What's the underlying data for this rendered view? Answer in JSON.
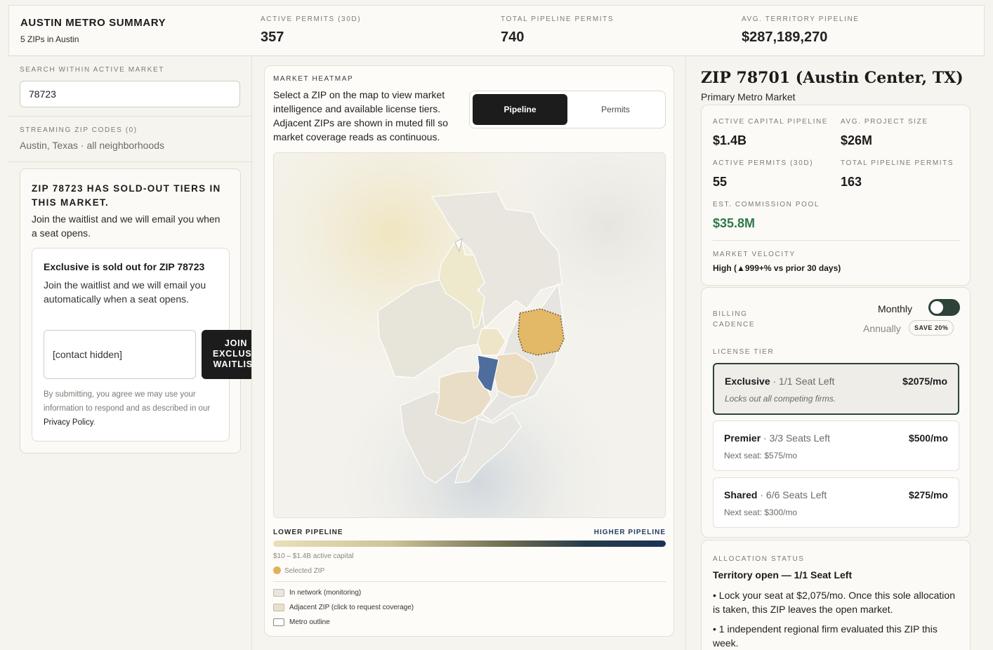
{
  "summary": {
    "title": "AUSTIN METRO SUMMARY",
    "subtitle": "5 ZIPs in Austin",
    "kpis": [
      {
        "label": "ACTIVE PERMITS (30D)",
        "value": "357"
      },
      {
        "label": "TOTAL PIPELINE PERMITS",
        "value": "740"
      },
      {
        "label": "AVG. TERRITORY PIPELINE",
        "value": "$287,189,270"
      }
    ]
  },
  "left": {
    "search_label": "SEARCH WITHIN ACTIVE MARKET",
    "search_value": "78723",
    "streaming_label": "STREAMING ZIP CODES (0)",
    "streaming_sub": "Austin, Texas · all neighborhoods",
    "sold_title": "ZIP 78723 HAS SOLD-OUT TIERS IN THIS MARKET.",
    "sold_text": "Join the waitlist and we will email you when a seat opens.",
    "inner_title": "Exclusive is sold out for ZIP 78723",
    "inner_text": "Join the waitlist and we will email you automatically when a seat opens.",
    "contact_value": "[contact hidden]",
    "join_label": "JOIN EXCLUSIVE WAITLIST",
    "legal_text": "By submitting, you agree we may use your information to respond and as described in our",
    "legal_link": "Privacy Policy",
    "legal_end": "."
  },
  "middle": {
    "label": "MARKET HEATMAP",
    "description": "Select a ZIP on the map to view market intelligence and available license tiers. Adjacent ZIPs are shown in muted fill so market coverage reads as continuous.",
    "toggle_active": "Pipeline",
    "toggle_inactive": "Permits",
    "legend_low": "LOWER PIPELINE",
    "legend_high": "HIGHER PIPELINE",
    "range": "$10 – $1.4B active capital",
    "selected": "Selected ZIP",
    "legend_items": [
      {
        "label": "In network (monitoring)"
      },
      {
        "label": "Adjacent ZIP (click to request coverage)"
      },
      {
        "label": "Metro outline"
      }
    ]
  },
  "right": {
    "zip_title": "ZIP 78701 (Austin Center, TX)",
    "zip_sub": "Primary Metro Market",
    "stats": [
      {
        "label": "ACTIVE CAPITAL PIPELINE",
        "value": "$1.4B"
      },
      {
        "label": "AVG. PROJECT SIZE",
        "value": "$26M"
      },
      {
        "label": "ACTIVE PERMITS (30D)",
        "value": "55"
      },
      {
        "label": "TOTAL PIPELINE PERMITS",
        "value": "163"
      },
      {
        "label": "EST. COMMISSION POOL",
        "value": "$35.8M"
      }
    ],
    "velocity_label": "MARKET VELOCITY",
    "velocity_value": "High (▲999+% vs prior 30 days)",
    "billing_label": "BILLING CADENCE",
    "monthly": "Monthly",
    "annually": "Annually",
    "save_badge": "SAVE 20%",
    "license_label": "LICENSE TIER",
    "tiers": [
      {
        "name": "Exclusive",
        "seats": " · 1/1 Seat Left",
        "price": "$2075/mo",
        "sub": "Locks out all competing firms."
      },
      {
        "name": "Premier",
        "seats": " · 3/3 Seats Left",
        "price": "$500/mo",
        "sub": "Next seat: $575/mo"
      },
      {
        "name": "Shared",
        "seats": " · 6/6 Seats Left",
        "price": "$275/mo",
        "sub": "Next seat: $300/mo"
      }
    ],
    "alloc_label": "ALLOCATION STATUS",
    "alloc_title": "Territory open — 1/1 Seat Left",
    "alloc_bullets": [
      "• Lock your seat at $2,075/mo. Once this sole allocation is taken, this ZIP leaves the open market.",
      "• 1 independent regional firm evaluated this ZIP this week."
    ]
  },
  "colors": {
    "accent_dark": "#1c1c1c",
    "selected_zip": "#e0b25e",
    "highlight_zip": "#4e6c9c",
    "commission_green": "#2e7a4b",
    "toggle_green": "#2d4238"
  }
}
